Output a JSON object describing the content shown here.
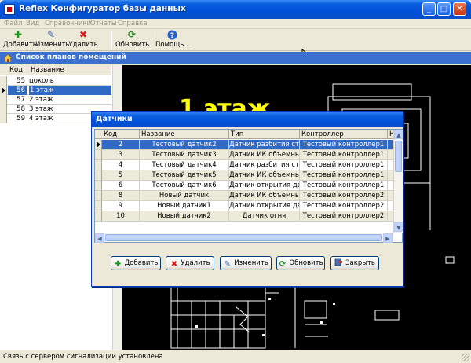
{
  "window": {
    "title": "Reflex Конфигуратор базы данных",
    "min_label": "_",
    "max_label": "□",
    "close_label": "✕"
  },
  "menu": [
    "Файл",
    "Вид",
    "Справочники",
    "Отчеты",
    "Справка"
  ],
  "toolbar": {
    "add": "Добавить",
    "edit": "Изменить",
    "delete": "Удалить",
    "refresh": "Обновить",
    "help": "Помощь..."
  },
  "plans": {
    "header": "Список планов помещений",
    "columns": [
      "Код",
      "Название"
    ],
    "rows": [
      {
        "code": "55",
        "name": "цоколь"
      },
      {
        "code": "56",
        "name": "1 этаж"
      },
      {
        "code": "57",
        "name": "2 этаж"
      },
      {
        "code": "58",
        "name": "3 этаж"
      },
      {
        "code": "59",
        "name": "4 этаж"
      }
    ],
    "selected_index": 1
  },
  "floorplan": {
    "title": "1 этаж"
  },
  "dialog": {
    "title": "Датчики",
    "columns": [
      "Код",
      "Название",
      "Тип",
      "Контроллер",
      "Н"
    ],
    "rows": [
      {
        "code": "2",
        "name": "Тестовый датчик2",
        "type": "Датчик разбития стек",
        "controller": "Тестовый контроллер1"
      },
      {
        "code": "3",
        "name": "Тестовый датчик3",
        "type": "Датчик ИК объемный",
        "controller": "Тестовый контроллер1"
      },
      {
        "code": "4",
        "name": "Тестовый датчик4",
        "type": "Датчик разбития стек",
        "controller": "Тестовый контроллер1"
      },
      {
        "code": "5",
        "name": "Тестовый датчик5",
        "type": "Датчик ИК объемный",
        "controller": "Тестовый контроллер1"
      },
      {
        "code": "6",
        "name": "Тестовый датчик6",
        "type": "Датчик открытия двер",
        "controller": "Тестовый контроллер1"
      },
      {
        "code": "8",
        "name": "Новый датчик",
        "type": "Датчик ИК объемный",
        "controller": "Тестовый контроллер2"
      },
      {
        "code": "9",
        "name": "Новый датчик1",
        "type": "Датчик открытия двер",
        "controller": "Тестовый контроллер2"
      },
      {
        "code": "10",
        "name": "Новый датчик2",
        "type": "Датчик огня",
        "controller": "Тестовый контроллер2"
      }
    ],
    "selected_index": 0,
    "buttons": {
      "add": "Добавить",
      "delete": "Удалить",
      "edit": "Изменить",
      "refresh": "Обновить",
      "close": "Закрыть"
    }
  },
  "status": {
    "text": "Связь с сервером сигнализации установлена"
  },
  "colors": {
    "selection": "#316ac5",
    "titlebar": "#0050d8",
    "plan_title": "#ffff00",
    "plan_background": "#000000"
  },
  "icons": {
    "add": "plus-icon",
    "edit": "pencil-icon",
    "delete": "x-icon",
    "refresh": "refresh-icon",
    "help": "help-icon",
    "close": "close-door-icon",
    "header": "home-icon"
  }
}
